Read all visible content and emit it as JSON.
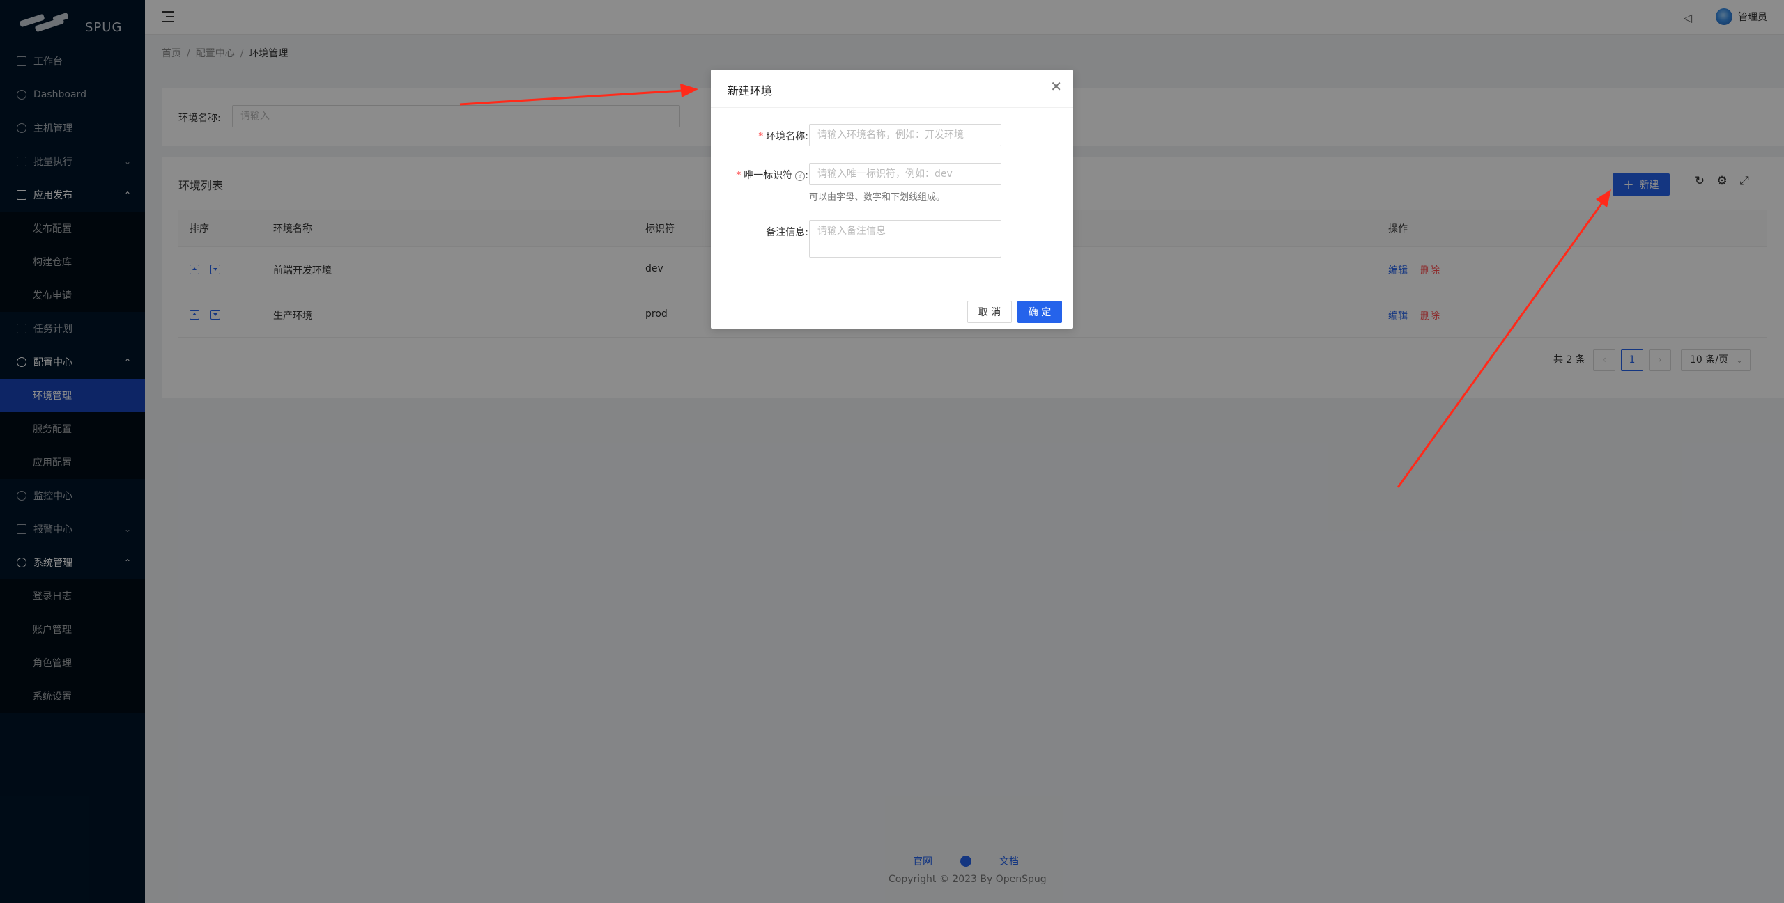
{
  "brand": {
    "logo_text": "SPUG"
  },
  "sidebar": {
    "items": [
      {
        "label": "工作台"
      },
      {
        "label": "Dashboard"
      },
      {
        "label": "主机管理"
      },
      {
        "label": "批量执行"
      },
      {
        "label": "应用发布"
      },
      {
        "label": "发布配置"
      },
      {
        "label": "构建仓库"
      },
      {
        "label": "发布申请"
      },
      {
        "label": "任务计划"
      },
      {
        "label": "配置中心"
      },
      {
        "label": "环境管理"
      },
      {
        "label": "服务配置"
      },
      {
        "label": "应用配置"
      },
      {
        "label": "监控中心"
      },
      {
        "label": "报警中心"
      },
      {
        "label": "系统管理"
      },
      {
        "label": "登录日志"
      },
      {
        "label": "账户管理"
      },
      {
        "label": "角色管理"
      },
      {
        "label": "系统设置"
      }
    ],
    "active": "环境管理"
  },
  "header": {
    "username": "管理员"
  },
  "breadcrumb": [
    "首页",
    "配置中心",
    "环境管理"
  ],
  "search": {
    "label": "环境名称:",
    "placeholder": "请输入"
  },
  "table": {
    "title": "环境列表",
    "new_button": "新建",
    "columns": [
      "排序",
      "环境名称",
      "标识符",
      "操作"
    ],
    "rows": [
      {
        "name": "前端开发环境",
        "key": "dev"
      },
      {
        "name": "生产环境",
        "key": "prod"
      }
    ],
    "action_edit": "编辑",
    "action_delete": "删除"
  },
  "pagination": {
    "total_text": "共 2 条",
    "current_page": "1",
    "page_size": "10 条/页"
  },
  "footer": {
    "link_site": "官网",
    "link_docs": "文档",
    "copyright": "Copyright © 2023 By OpenSpug"
  },
  "modal": {
    "title": "新建环境",
    "field_name_label": "环境名称:",
    "field_name_placeholder": "请输入环境名称，例如：开发环境",
    "field_key_label": "唯一标识符",
    "field_key_placeholder": "请输入唯一标识符，例如：dev",
    "field_key_help": "可以由字母、数字和下划线组成。",
    "field_desc_label": "备注信息:",
    "field_desc_placeholder": "请输入备注信息",
    "cancel": "取 消",
    "ok": "确 定"
  },
  "colors": {
    "primary": "#2563eb",
    "sidebar_bg": "#001529",
    "danger": "#ff4d4f",
    "annotation": "#ff2a1a"
  }
}
